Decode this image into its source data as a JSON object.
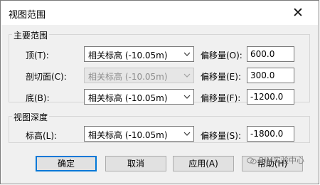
{
  "window": {
    "title": "视图范围",
    "close_glyph": "✕"
  },
  "main_range": {
    "group_label": "主要范围",
    "rows": [
      {
        "label": "顶(T):",
        "select_value": "相关标高 (-10.05m)",
        "offset_label": "偏移量(O):",
        "offset_value": "600.0",
        "disabled": false
      },
      {
        "label": "剖切面(C):",
        "select_value": "相关标高 (-10.05m)",
        "offset_label": "偏移量(E):",
        "offset_value": "300.0",
        "disabled": true
      },
      {
        "label": "底(B):",
        "select_value": "相关标高 (-10.05m)",
        "offset_label": "偏移量(F):",
        "offset_value": "-1200.0",
        "disabled": false
      }
    ]
  },
  "view_depth": {
    "group_label": "视图深度",
    "rows": [
      {
        "label": "标高(L):",
        "select_value": "相关标高 (-10.05m)",
        "offset_label": "偏移量(S):",
        "offset_value": "-1800.0"
      }
    ]
  },
  "buttons": {
    "ok": "确定",
    "cancel": "取消",
    "apply": "应用(A)",
    "help": "帮助(H)"
  },
  "watermark": {
    "text": "BIM实验中心",
    "icon": "wechat-icon"
  },
  "colors": {
    "focus_border": "#0078d7",
    "dialog_bg": "#f0f0f0"
  }
}
